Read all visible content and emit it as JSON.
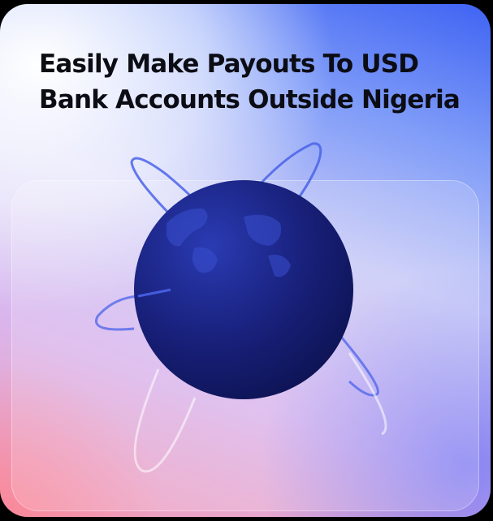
{
  "card": {
    "headline": "Easily Make Payouts To USD Bank Accounts Outside Nigeria"
  },
  "illustration": {
    "icon": "globe-with-orbits-icon",
    "colors": {
      "globe_dark": "#111a66",
      "globe_light": "#2a3bb3",
      "orbit": "#4a63ea"
    }
  },
  "colors": {
    "accent_blue": "#3f63f3",
    "accent_pink": "#f49ab3",
    "text": "#0c0c14"
  }
}
